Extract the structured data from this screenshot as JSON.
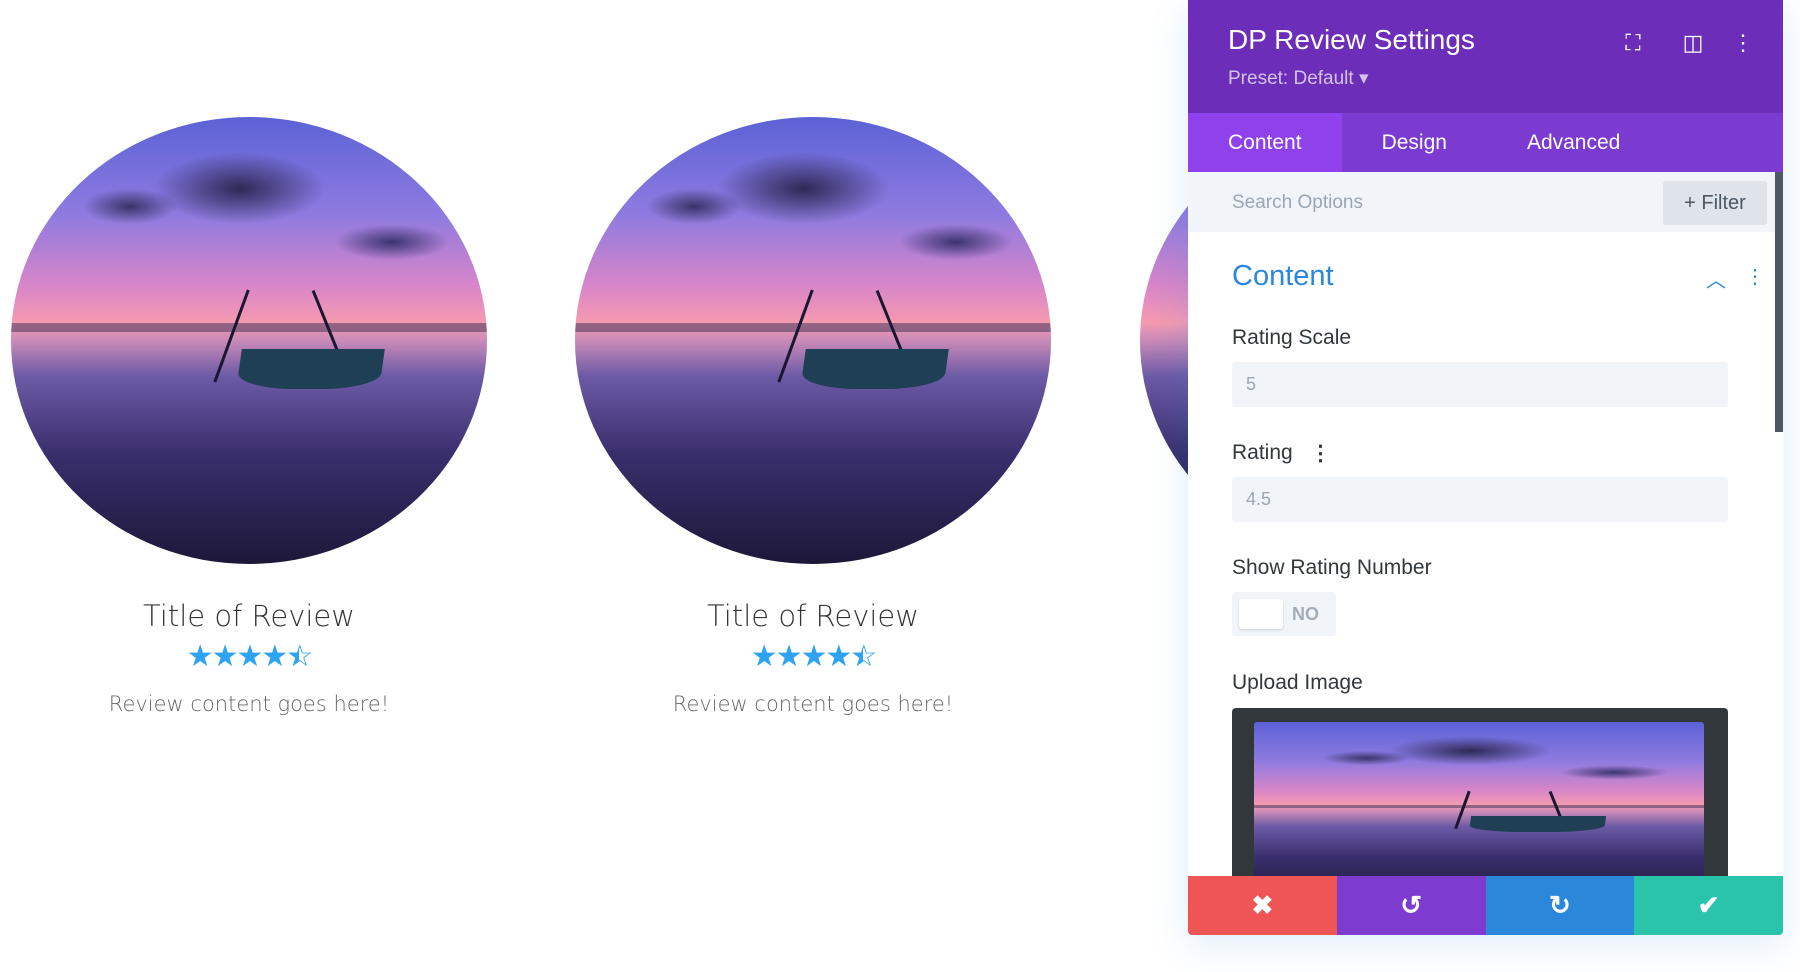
{
  "reviews": [
    {
      "title": "Title of Review",
      "stars": "★★★★",
      "rating": 4.5,
      "content": "Review content goes here!"
    },
    {
      "title": "Title of Review",
      "stars": "★★★★",
      "rating": 4.5,
      "content": "Review content goes here!"
    }
  ],
  "panel": {
    "title": "DP Review Settings",
    "preset": "Preset: Default ▾",
    "icons": {
      "focus": "⛶",
      "layout": "◫",
      "more": "⋮"
    },
    "tabs": [
      "Content",
      "Design",
      "Advanced"
    ],
    "search_placeholder": "Search Options",
    "filter_label": "+ Filter",
    "section_title": "Content",
    "fields": {
      "rating_scale_label": "Rating Scale",
      "rating_scale_value": "5",
      "rating_label": "Rating",
      "rating_value": "4.5",
      "show_number_label": "Show Rating Number",
      "show_number_value": "NO",
      "upload_label": "Upload Image"
    },
    "actions": {
      "cancel": "✖",
      "undo": "↺",
      "redo": "↻",
      "save": "✔"
    },
    "colors": {
      "header": "#6c2eb9",
      "tabs": "#7b3bd0",
      "accent": "#2b87da",
      "cancel": "#ef5555",
      "undo": "#7e3bd0",
      "redo": "#2b87da",
      "save": "#29c4a9",
      "stars": "#2ea3f2"
    }
  }
}
